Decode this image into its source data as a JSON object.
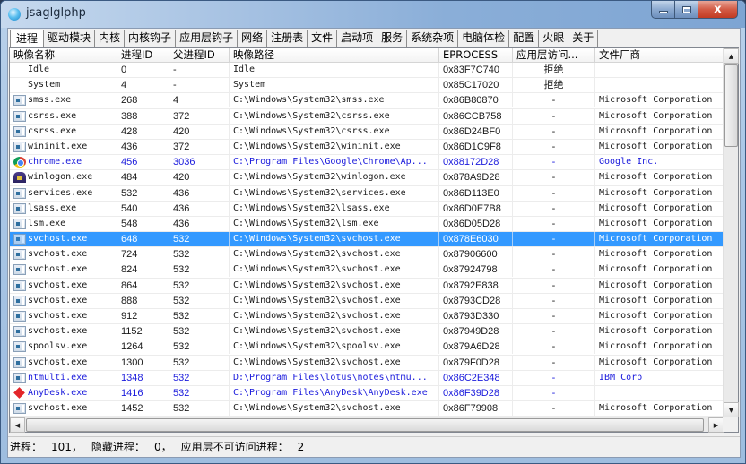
{
  "window": {
    "title": "jsaglglphp",
    "icon": "app-orb-icon",
    "controls": {
      "minimize": "minimize",
      "maximize": "maximize",
      "close": "x"
    }
  },
  "tabs": [
    {
      "label": "进程",
      "active": true
    },
    {
      "label": "驱动模块"
    },
    {
      "label": "内核"
    },
    {
      "label": "内核钩子"
    },
    {
      "label": "应用层钩子"
    },
    {
      "label": "网络"
    },
    {
      "label": "注册表"
    },
    {
      "label": "文件"
    },
    {
      "label": "启动项"
    },
    {
      "label": "服务"
    },
    {
      "label": "系统杂项"
    },
    {
      "label": "电脑体检"
    },
    {
      "label": "配置"
    },
    {
      "label": "火眼"
    },
    {
      "label": "关于"
    }
  ],
  "table": {
    "columns": [
      "映像名称",
      "进程ID",
      "父进程ID",
      "映像路径",
      "EPROCESS",
      "应用层访问...",
      "文件厂商"
    ],
    "rows": [
      {
        "icon": "none",
        "name": "Idle",
        "pid": "0",
        "ppid": "-",
        "path": "Idle",
        "eprocess": "0x83F7C740",
        "access": "拒绝",
        "vendor": ""
      },
      {
        "icon": "none",
        "name": "System",
        "pid": "4",
        "ppid": "-",
        "path": "System",
        "eprocess": "0x85C17020",
        "access": "拒绝",
        "vendor": ""
      },
      {
        "icon": "exe",
        "name": "smss.exe",
        "pid": "268",
        "ppid": "4",
        "path": "C:\\Windows\\System32\\smss.exe",
        "eprocess": "0x86B80870",
        "access": "-",
        "vendor": "Microsoft Corporation"
      },
      {
        "icon": "exe",
        "name": "csrss.exe",
        "pid": "388",
        "ppid": "372",
        "path": "C:\\Windows\\System32\\csrss.exe",
        "eprocess": "0x86CCB758",
        "access": "-",
        "vendor": "Microsoft Corporation"
      },
      {
        "icon": "exe",
        "name": "csrss.exe",
        "pid": "428",
        "ppid": "420",
        "path": "C:\\Windows\\System32\\csrss.exe",
        "eprocess": "0x86D24BF0",
        "access": "-",
        "vendor": "Microsoft Corporation"
      },
      {
        "icon": "exe",
        "name": "wininit.exe",
        "pid": "436",
        "ppid": "372",
        "path": "C:\\Windows\\System32\\wininit.exe",
        "eprocess": "0x86D1C9F8",
        "access": "-",
        "vendor": "Microsoft Corporation"
      },
      {
        "icon": "chrome",
        "name": "chrome.exe",
        "pid": "456",
        "ppid": "3036",
        "path": "C:\\Program Files\\Google\\Chrome\\Ap...",
        "eprocess": "0x88172D28",
        "access": "-",
        "vendor": "Google Inc.",
        "highlight": "blue"
      },
      {
        "icon": "winlogon",
        "name": "winlogon.exe",
        "pid": "484",
        "ppid": "420",
        "path": "C:\\Windows\\System32\\winlogon.exe",
        "eprocess": "0x878A9D28",
        "access": "-",
        "vendor": "Microsoft Corporation"
      },
      {
        "icon": "exe",
        "name": "services.exe",
        "pid": "532",
        "ppid": "436",
        "path": "C:\\Windows\\System32\\services.exe",
        "eprocess": "0x86D113E0",
        "access": "-",
        "vendor": "Microsoft Corporation"
      },
      {
        "icon": "exe",
        "name": "lsass.exe",
        "pid": "540",
        "ppid": "436",
        "path": "C:\\Windows\\System32\\lsass.exe",
        "eprocess": "0x86D0E7B8",
        "access": "-",
        "vendor": "Microsoft Corporation"
      },
      {
        "icon": "exe",
        "name": "lsm.exe",
        "pid": "548",
        "ppid": "436",
        "path": "C:\\Windows\\System32\\lsm.exe",
        "eprocess": "0x86D05D28",
        "access": "-",
        "vendor": "Microsoft Corporation"
      },
      {
        "icon": "exe",
        "name": "svchost.exe",
        "pid": "648",
        "ppid": "532",
        "path": "C:\\Windows\\System32\\svchost.exe",
        "eprocess": "0x878E6030",
        "access": "-",
        "vendor": "Microsoft Corporation",
        "selected": true
      },
      {
        "icon": "exe",
        "name": "svchost.exe",
        "pid": "724",
        "ppid": "532",
        "path": "C:\\Windows\\System32\\svchost.exe",
        "eprocess": "0x87906600",
        "access": "-",
        "vendor": "Microsoft Corporation"
      },
      {
        "icon": "exe",
        "name": "svchost.exe",
        "pid": "824",
        "ppid": "532",
        "path": "C:\\Windows\\System32\\svchost.exe",
        "eprocess": "0x87924798",
        "access": "-",
        "vendor": "Microsoft Corporation"
      },
      {
        "icon": "exe",
        "name": "svchost.exe",
        "pid": "864",
        "ppid": "532",
        "path": "C:\\Windows\\System32\\svchost.exe",
        "eprocess": "0x8792E838",
        "access": "-",
        "vendor": "Microsoft Corporation"
      },
      {
        "icon": "exe",
        "name": "svchost.exe",
        "pid": "888",
        "ppid": "532",
        "path": "C:\\Windows\\System32\\svchost.exe",
        "eprocess": "0x8793CD28",
        "access": "-",
        "vendor": "Microsoft Corporation"
      },
      {
        "icon": "exe",
        "name": "svchost.exe",
        "pid": "912",
        "ppid": "532",
        "path": "C:\\Windows\\System32\\svchost.exe",
        "eprocess": "0x8793D330",
        "access": "-",
        "vendor": "Microsoft Corporation"
      },
      {
        "icon": "exe",
        "name": "svchost.exe",
        "pid": "1152",
        "ppid": "532",
        "path": "C:\\Windows\\System32\\svchost.exe",
        "eprocess": "0x87949D28",
        "access": "-",
        "vendor": "Microsoft Corporation"
      },
      {
        "icon": "exe",
        "name": "spoolsv.exe",
        "pid": "1264",
        "ppid": "532",
        "path": "C:\\Windows\\System32\\spoolsv.exe",
        "eprocess": "0x879A6D28",
        "access": "-",
        "vendor": "Microsoft Corporation"
      },
      {
        "icon": "exe",
        "name": "svchost.exe",
        "pid": "1300",
        "ppid": "532",
        "path": "C:\\Windows\\System32\\svchost.exe",
        "eprocess": "0x879F0D28",
        "access": "-",
        "vendor": "Microsoft Corporation"
      },
      {
        "icon": "exe",
        "name": "ntmulti.exe",
        "pid": "1348",
        "ppid": "532",
        "path": "D:\\Program Files\\lotus\\notes\\ntmu...",
        "eprocess": "0x86C2E348",
        "access": "-",
        "vendor": "IBM Corp",
        "highlight": "blue"
      },
      {
        "icon": "anydesk",
        "name": "AnyDesk.exe",
        "pid": "1416",
        "ppid": "532",
        "path": "C:\\Program Files\\AnyDesk\\AnyDesk.exe",
        "eprocess": "0x86F39D28",
        "access": "-",
        "vendor": "",
        "highlight": "blue"
      },
      {
        "icon": "exe",
        "name": "svchost.exe",
        "pid": "1452",
        "ppid": "532",
        "path": "C:\\Windows\\System32\\svchost.exe",
        "eprocess": "0x86F79908",
        "access": "-",
        "vendor": "Microsoft Corporation"
      }
    ]
  },
  "scrollbars": {
    "up": "▲",
    "down": "▼",
    "left": "◀",
    "right": "▶"
  },
  "status": {
    "process_label": "进程：",
    "process_count": "101，",
    "hidden_label": "隐藏进程：",
    "hidden_count": "0，",
    "inaccessible_label": "应用层不可访问进程：",
    "inaccessible_count": "2"
  },
  "colors": {
    "selection": "#3399ff",
    "highlight_blue": "#1a1adc"
  }
}
